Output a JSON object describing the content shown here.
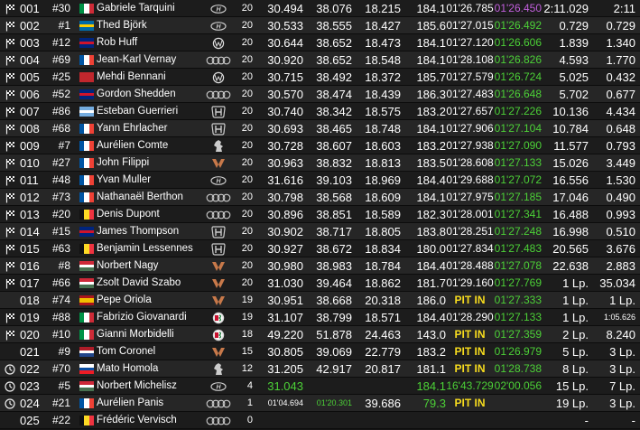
{
  "colors": {
    "green": "#4cd137",
    "purple": "#c15fdc",
    "pit": "#f7dc1e"
  },
  "rows": [
    {
      "pos": "001",
      "num": "#30",
      "flag": "it",
      "driver": "Gabriele Tarquini",
      "make": "hyundai",
      "laps": "20",
      "s1": "30.494",
      "s2": "38.076",
      "s3": "18.215",
      "speed": "184.1",
      "last": "01'26.785",
      "best": "01'26.450",
      "gap": "2:11.029",
      "int": "2:11",
      "status": "flag",
      "bestColor": "purple"
    },
    {
      "pos": "002",
      "num": "#1",
      "flag": "se",
      "driver": "Thed Björk",
      "make": "hyundai",
      "laps": "20",
      "s1": "30.533",
      "s2": "38.555",
      "s3": "18.427",
      "speed": "185.6",
      "last": "01'27.015",
      "best": "01'26.492",
      "gap": "0.729",
      "int": "0.729",
      "status": "flag",
      "bestColor": "green"
    },
    {
      "pos": "003",
      "num": "#12",
      "flag": "gb",
      "driver": "Rob Huff",
      "make": "vw",
      "laps": "20",
      "s1": "30.644",
      "s2": "38.652",
      "s3": "18.473",
      "speed": "184.1",
      "last": "01'27.120",
      "best": "01'26.606",
      "gap": "1.839",
      "int": "1.340",
      "status": "flag",
      "bestColor": "green"
    },
    {
      "pos": "004",
      "num": "#69",
      "flag": "fr",
      "driver": "Jean-Karl Vernay",
      "make": "audi",
      "laps": "20",
      "s1": "30.920",
      "s2": "38.652",
      "s3": "18.548",
      "speed": "184.1",
      "last": "01'28.108",
      "best": "01'26.826",
      "gap": "4.593",
      "int": "1.770",
      "status": "flag",
      "bestColor": "green"
    },
    {
      "pos": "005",
      "num": "#25",
      "flag": "ma",
      "driver": "Mehdi Bennani",
      "make": "vw",
      "laps": "20",
      "s1": "30.715",
      "s2": "38.492",
      "s3": "18.372",
      "speed": "185.7",
      "last": "01'27.579",
      "best": "01'26.724",
      "gap": "5.025",
      "int": "0.432",
      "status": "flag",
      "bestColor": "green"
    },
    {
      "pos": "006",
      "num": "#52",
      "flag": "gb",
      "driver": "Gordon Shedden",
      "make": "audi",
      "laps": "20",
      "s1": "30.570",
      "s2": "38.474",
      "s3": "18.439",
      "speed": "186.3",
      "last": "01'27.483",
      "best": "01'26.648",
      "gap": "5.702",
      "int": "0.677",
      "status": "flag",
      "bestColor": "green"
    },
    {
      "pos": "007",
      "num": "#86",
      "flag": "ar",
      "driver": "Esteban Guerrieri",
      "make": "honda",
      "laps": "20",
      "s1": "30.740",
      "s2": "38.342",
      "s3": "18.575",
      "speed": "183.2",
      "last": "01'27.657",
      "best": "01'27.226",
      "gap": "10.136",
      "int": "4.434",
      "status": "flag",
      "bestColor": "green"
    },
    {
      "pos": "008",
      "num": "#68",
      "flag": "fr",
      "driver": "Yann Ehrlacher",
      "make": "honda",
      "laps": "20",
      "s1": "30.693",
      "s2": "38.465",
      "s3": "18.748",
      "speed": "184.1",
      "last": "01'27.906",
      "best": "01'27.104",
      "gap": "10.784",
      "int": "0.648",
      "status": "flag",
      "bestColor": "green"
    },
    {
      "pos": "009",
      "num": "#7",
      "flag": "fr",
      "driver": "Aurélien Comte",
      "make": "peugeot",
      "laps": "20",
      "s1": "30.728",
      "s2": "38.607",
      "s3": "18.603",
      "speed": "183.2",
      "last": "01'27.938",
      "best": "01'27.090",
      "gap": "11.577",
      "int": "0.793",
      "status": "flag",
      "bestColor": "green"
    },
    {
      "pos": "010",
      "num": "#27",
      "flag": "fr",
      "driver": "John Filippi",
      "make": "cupra",
      "laps": "20",
      "s1": "30.963",
      "s2": "38.832",
      "s3": "18.813",
      "speed": "183.5",
      "last": "01'28.608",
      "best": "01'27.133",
      "gap": "15.026",
      "int": "3.449",
      "status": "flag",
      "bestColor": "green"
    },
    {
      "pos": "011",
      "num": "#48",
      "flag": "fr",
      "driver": "Yvan Muller",
      "make": "hyundai",
      "laps": "20",
      "s1": "31.616",
      "s2": "39.103",
      "s3": "18.969",
      "speed": "184.4",
      "last": "01'29.688",
      "best": "01'27.072",
      "gap": "16.556",
      "int": "1.530",
      "status": "flag",
      "bestColor": "green"
    },
    {
      "pos": "012",
      "num": "#73",
      "flag": "fr",
      "driver": "Nathanaël Berthon",
      "make": "audi",
      "laps": "20",
      "s1": "30.798",
      "s2": "38.568",
      "s3": "18.609",
      "speed": "184.1",
      "last": "01'27.975",
      "best": "01'27.185",
      "gap": "17.046",
      "int": "0.490",
      "status": "flag",
      "bestColor": "green"
    },
    {
      "pos": "013",
      "num": "#20",
      "flag": "be",
      "driver": "Denis Dupont",
      "make": "audi",
      "laps": "20",
      "s1": "30.896",
      "s2": "38.851",
      "s3": "18.589",
      "speed": "182.3",
      "last": "01'28.001",
      "best": "01'27.341",
      "gap": "16.488",
      "int": "0.993",
      "status": "flag",
      "bestColor": "green"
    },
    {
      "pos": "014",
      "num": "#15",
      "flag": "gb",
      "driver": "James Thompson",
      "make": "honda",
      "laps": "20",
      "s1": "30.902",
      "s2": "38.717",
      "s3": "18.805",
      "speed": "183.8",
      "last": "01'28.251",
      "best": "01'27.248",
      "gap": "16.998",
      "int": "0.510",
      "status": "flag",
      "bestColor": "green"
    },
    {
      "pos": "015",
      "num": "#63",
      "flag": "be",
      "driver": "Benjamin Lessennes",
      "make": "honda",
      "laps": "20",
      "s1": "30.927",
      "s2": "38.672",
      "s3": "18.834",
      "speed": "180.0",
      "last": "01'27.834",
      "best": "01'27.483",
      "gap": "20.565",
      "int": "3.676",
      "status": "flag",
      "bestColor": "green"
    },
    {
      "pos": "016",
      "num": "#8",
      "flag": "hu",
      "driver": "Norbert Nagy",
      "make": "cupra",
      "laps": "20",
      "s1": "30.980",
      "s2": "38.983",
      "s3": "18.784",
      "speed": "184.4",
      "last": "01'28.488",
      "best": "01'27.078",
      "gap": "22.638",
      "int": "2.883",
      "status": "flag",
      "bestColor": "green"
    },
    {
      "pos": "017",
      "num": "#66",
      "flag": "hu",
      "driver": "Zsolt David Szabo",
      "make": "cupra",
      "laps": "20",
      "s1": "31.030",
      "s2": "39.464",
      "s3": "18.862",
      "speed": "181.7",
      "last": "01'29.160",
      "best": "01'27.769",
      "gap": "1 Lp.",
      "int": "35.034",
      "status": "flag",
      "bestColor": "green"
    },
    {
      "pos": "018",
      "num": "#74",
      "flag": "es",
      "driver": "Pepe Oriola",
      "make": "cupra",
      "laps": "19",
      "s1": "30.951",
      "s2": "38.668",
      "s3": "20.318",
      "speed": "186.0",
      "last": "PIT IN",
      "best": "01'27.333",
      "gap": "1 Lp.",
      "int": "1 Lp.",
      "status": "none",
      "bestColor": "green"
    },
    {
      "pos": "019",
      "num": "#88",
      "flag": "it",
      "driver": "Fabrizio Giovanardi",
      "make": "alfa",
      "laps": "19",
      "s1": "31.107",
      "s2": "38.799",
      "s3": "18.571",
      "speed": "184.4",
      "last": "01'28.290",
      "best": "01'27.133",
      "gap": "1 Lp.",
      "int": "1:05.626",
      "status": "flag",
      "bestColor": "green"
    },
    {
      "pos": "020",
      "num": "#10",
      "flag": "it",
      "driver": "Gianni Morbidelli",
      "make": "alfa",
      "laps": "18",
      "s1": "49.220",
      "s2": "51.878",
      "s3": "24.463",
      "speed": "143.0",
      "last": "PIT IN",
      "best": "01'27.359",
      "gap": "2 Lp.",
      "int": "8.240",
      "status": "flag",
      "bestColor": "green"
    },
    {
      "pos": "021",
      "num": "#9",
      "flag": "nl",
      "driver": "Tom Coronel",
      "make": "cupra",
      "laps": "15",
      "s1": "30.805",
      "s2": "39.069",
      "s3": "22.779",
      "speed": "183.2",
      "last": "PIT IN",
      "best": "01'26.979",
      "gap": "5 Lp.",
      "int": "3 Lp.",
      "status": "none",
      "bestColor": "green"
    },
    {
      "pos": "022",
      "num": "#70",
      "flag": "sk",
      "driver": "Mato Homola",
      "make": "peugeot",
      "laps": "12",
      "s1": "31.205",
      "s2": "42.917",
      "s3": "20.817",
      "speed": "181.1",
      "last": "PIT IN",
      "best": "01'28.738",
      "gap": "8 Lp.",
      "int": "3 Lp.",
      "status": "clock",
      "bestColor": "green"
    },
    {
      "pos": "023",
      "num": "#5",
      "flag": "hu",
      "driver": "Norbert Michelisz",
      "make": "hyundai",
      "laps": "4",
      "s1": "31.043",
      "s2": "",
      "s3": "",
      "speed": "184.1",
      "last": "16'43.729",
      "best": "02'00.056",
      "gap": "15 Lp.",
      "int": "7 Lp.",
      "status": "clock",
      "bestColor": "green",
      "s1Color": "green",
      "speedColor": "green",
      "lastColor": "green"
    },
    {
      "pos": "024",
      "num": "#21",
      "flag": "fr",
      "driver": "Aurélien Panis",
      "make": "audi",
      "laps": "1",
      "s1": "01'04.694",
      "s2": "01'20.301",
      "s3": "39.686",
      "speed": "79.3",
      "last": "PIT IN",
      "best": "",
      "gap": "19 Lp.",
      "int": "3 Lp.",
      "status": "clock",
      "bestColor": "green",
      "s1Small": true,
      "s2Small": true,
      "s2Color": "green",
      "speedColor": "green"
    },
    {
      "pos": "025",
      "num": "#22",
      "flag": "be",
      "driver": "Frédéric Vervisch",
      "make": "audi",
      "laps": "0",
      "s1": "",
      "s2": "",
      "s3": "",
      "speed": "",
      "last": "",
      "best": "",
      "gap": "-",
      "int": "-",
      "status": "none",
      "bestColor": "green"
    }
  ]
}
